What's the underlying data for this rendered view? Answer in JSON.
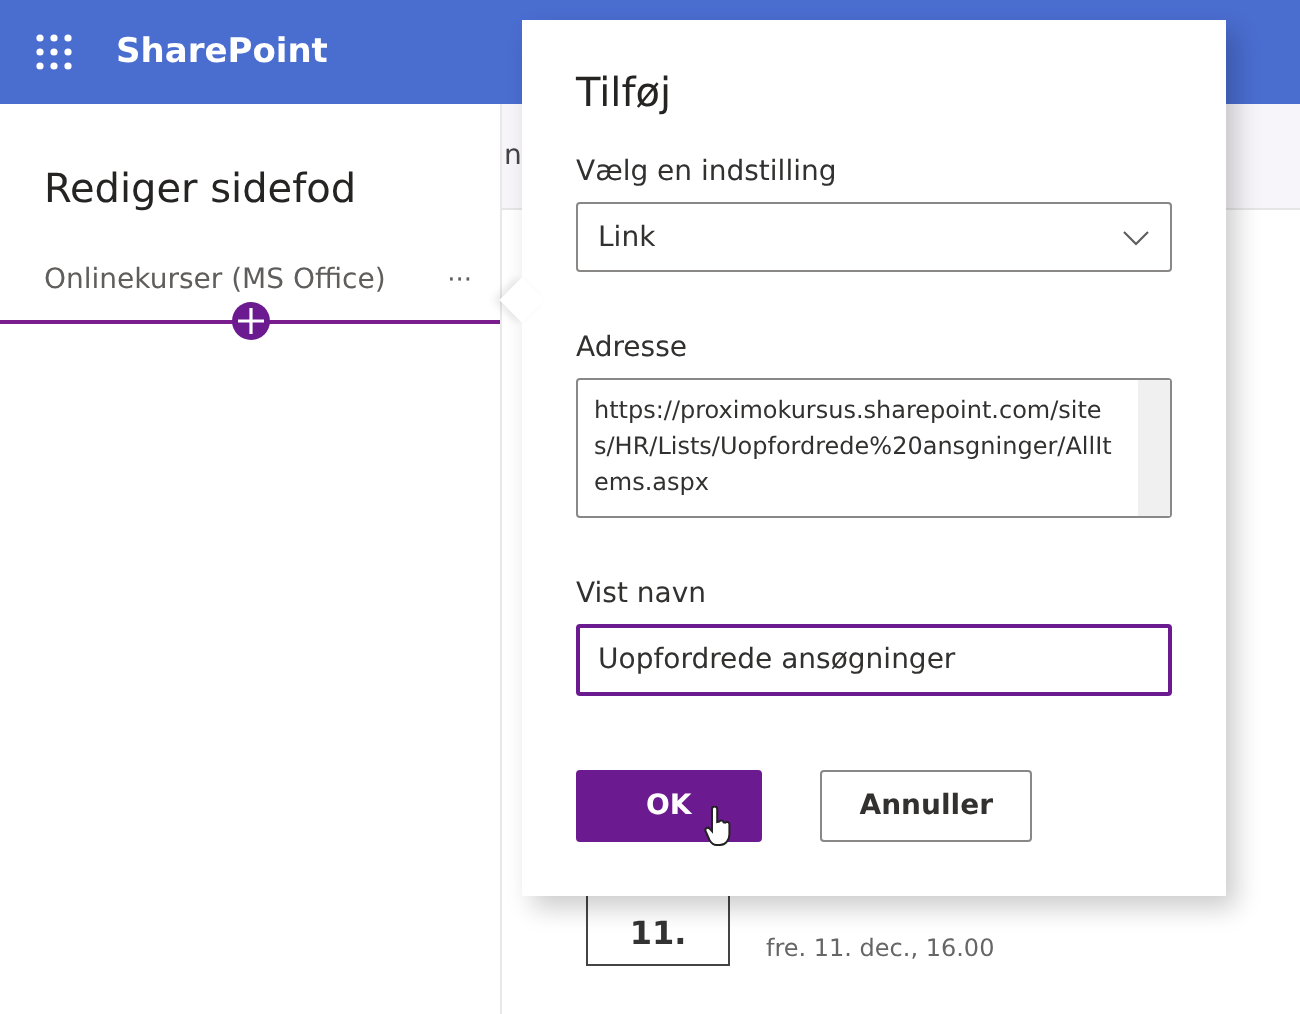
{
  "header": {
    "app_name": "SharePoint"
  },
  "edit_panel": {
    "title": "Rediger sidefod",
    "items": [
      {
        "label": "Onlinekurser (MS Office)",
        "more": "···"
      }
    ]
  },
  "background": {
    "tab_fragment": "n",
    "event": {
      "day": "11.",
      "when": "fre. 11. dec., 16.00"
    }
  },
  "dialog": {
    "title": "Tilføj",
    "fields": [
      {
        "kind": "dropdown",
        "label": "Vælg en indstilling",
        "value": "Link",
        "focused": false
      },
      {
        "kind": "textarea",
        "label": "Adresse",
        "value": "https://proximokursus.sharepoint.com/sites/HR/Lists/Uopfordrede%20ansgninger/AllItems.aspx",
        "focused": false
      },
      {
        "kind": "text",
        "label": "Vist navn",
        "value": "Uopfordrede ansøgninger",
        "focused": true
      }
    ],
    "buttons": [
      {
        "label": "OK",
        "primary": true
      },
      {
        "label": "Annuller",
        "primary": false
      }
    ]
  }
}
